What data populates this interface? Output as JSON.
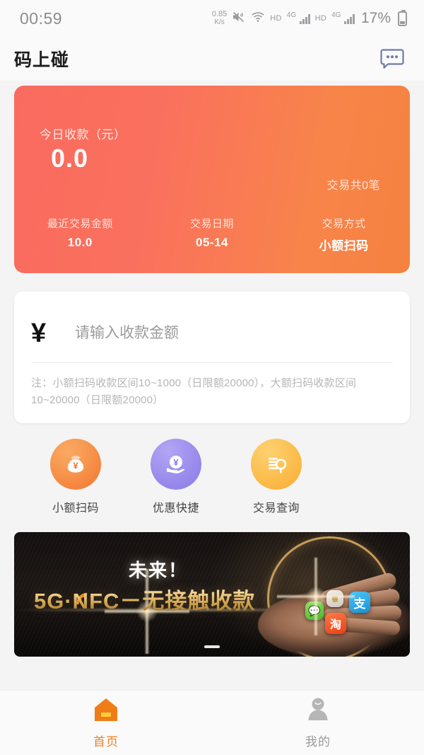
{
  "statusbar": {
    "time": "00:59",
    "net_speed_value": "0.85",
    "net_speed_unit": "K/s",
    "mute_icon": "mute-icon",
    "wifi_icon": "wifi-icon",
    "hd_label_1": "HD",
    "network_type_1": "4G",
    "hd_label_2": "HD",
    "network_type_2": "4G",
    "battery_percent": "17%"
  },
  "header": {
    "title": "码上碰",
    "message_icon": "message-bubble-icon"
  },
  "summary": {
    "today_label": "今日收款（元）",
    "today_amount": "0.0",
    "transaction_count": "交易共0笔",
    "stats": [
      {
        "label": "最近交易金额",
        "value": "10.0"
      },
      {
        "label": "交易日期",
        "value": "05-14"
      },
      {
        "label": "交易方式",
        "value": "小额扫码"
      }
    ],
    "gradient_from": "#fa6b5f",
    "gradient_to": "#f5823f"
  },
  "amount_card": {
    "currency_symbol": "¥",
    "input_value": "",
    "placeholder": "请输入收款金额",
    "note": "注：小额扫码收款区间10~1000（日限额20000），大额扫码收款区间10~20000（日限额20000）"
  },
  "actions": [
    {
      "label": "小额扫码",
      "icon": "money-bag-icon",
      "color": "#f4742e"
    },
    {
      "label": "优惠快捷",
      "icon": "hand-coin-icon",
      "color": "#8a7ae8"
    },
    {
      "label": "交易查询",
      "icon": "search-list-icon",
      "color": "#f8ab31"
    }
  ],
  "banner": {
    "subtitle": "未来！",
    "title": "5G·NFC－无接触收款",
    "app_icons": [
      {
        "name": "wechat-icon",
        "glyph": "💬"
      },
      {
        "name": "bank-app-icon",
        "glyph": "银"
      },
      {
        "name": "alipay-icon",
        "glyph": "支"
      },
      {
        "name": "taobao-icon",
        "glyph": "淘"
      }
    ],
    "page_indicator": "1"
  },
  "tabbar": {
    "tabs": [
      {
        "label": "首页",
        "icon": "home-icon",
        "active": true
      },
      {
        "label": "我的",
        "icon": "person-icon",
        "active": false
      }
    ]
  }
}
